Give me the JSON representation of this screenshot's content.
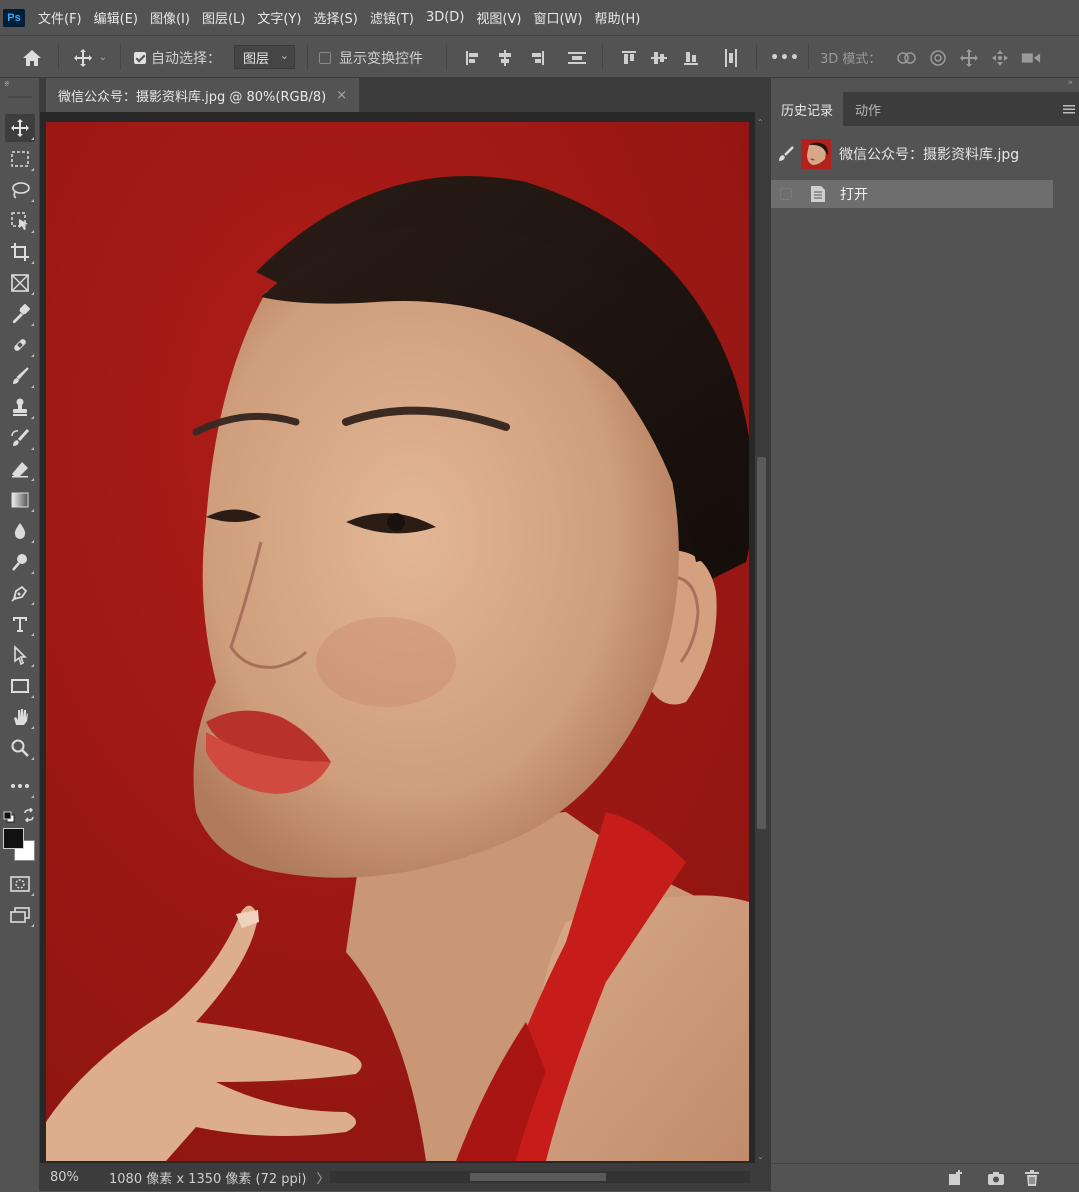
{
  "app": {
    "logo_text": "Ps",
    "menu": [
      "文件(F)",
      "编辑(E)",
      "图像(I)",
      "图层(L)",
      "文字(Y)",
      "选择(S)",
      "滤镜(T)",
      "3D(D)",
      "视图(V)",
      "窗口(W)",
      "帮助(H)"
    ]
  },
  "options_bar": {
    "auto_select_label": "自动选择：",
    "auto_select_checked": true,
    "auto_select_target": "图层",
    "show_transform_label": "显示变换控件",
    "show_transform_checked": false,
    "more_label": "•••",
    "mode_3d_label": "3D 模式："
  },
  "tools": [
    {
      "name": "move-tool",
      "icon": "move-icon"
    },
    {
      "name": "marquee-tool",
      "icon": "rect-marquee-icon"
    },
    {
      "name": "lasso-tool",
      "icon": "lasso-icon"
    },
    {
      "name": "object-select-tool",
      "icon": "object-select-icon"
    },
    {
      "name": "crop-tool",
      "icon": "crop-icon"
    },
    {
      "name": "frame-tool",
      "icon": "frame-icon"
    },
    {
      "name": "eyedropper-tool",
      "icon": "eyedropper-icon"
    },
    {
      "name": "healing-brush-tool",
      "icon": "bandage-icon"
    },
    {
      "name": "brush-tool",
      "icon": "brush-icon"
    },
    {
      "name": "clone-stamp-tool",
      "icon": "stamp-icon"
    },
    {
      "name": "history-brush-tool",
      "icon": "history-brush-icon"
    },
    {
      "name": "eraser-tool",
      "icon": "eraser-icon"
    },
    {
      "name": "gradient-tool",
      "icon": "gradient-icon"
    },
    {
      "name": "blur-tool",
      "icon": "droplet-icon"
    },
    {
      "name": "dodge-tool",
      "icon": "dodge-icon"
    },
    {
      "name": "pen-tool",
      "icon": "pen-icon"
    },
    {
      "name": "type-tool",
      "icon": "type-icon"
    },
    {
      "name": "path-select-tool",
      "icon": "arrow-select-icon"
    },
    {
      "name": "rectangle-tool",
      "icon": "rectangle-icon"
    },
    {
      "name": "hand-tool",
      "icon": "hand-icon"
    },
    {
      "name": "zoom-tool",
      "icon": "magnifier-icon"
    },
    {
      "name": "edit-toolbar",
      "icon": "ellipsis-icon"
    }
  ],
  "colors": {
    "foreground": "#111111",
    "background": "#ffffff",
    "photo_bg": "#a21916",
    "accent_ps": "#31a8ff"
  },
  "document": {
    "tab_title": "微信公众号：摄影资料库.jpg @ 80%(RGB/8)",
    "tab_close": "×",
    "zoom": "80%",
    "dimensions": "1080 像素 x 1350 像素 (72 ppi)",
    "status_arrow": "〉"
  },
  "panel": {
    "tabs": [
      "历史记录",
      "动作"
    ],
    "active_tab": 0,
    "snapshot_name": "微信公众号：摄影资料库.jpg",
    "history_items": [
      "打开"
    ]
  }
}
